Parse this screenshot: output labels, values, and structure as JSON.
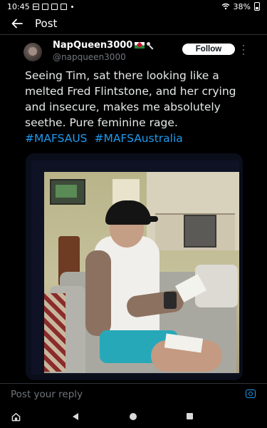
{
  "status_bar": {
    "time": "10:45",
    "battery": "38%"
  },
  "header": {
    "title": "Post"
  },
  "post": {
    "display_name": "NapQueen3000",
    "handle": "@napqueen3000",
    "follow_label": "Follow",
    "text_lines": [
      "Seeing Tim, sat there looking like a",
      "melted Fred Flintstone, and her crying",
      "and insecure, makes me absolutely",
      "seethe. Pure feminine rage."
    ],
    "hashtags": [
      "#MAFSAUS",
      "#MAFSAustralia"
    ]
  },
  "reply": {
    "placeholder": "Post your reply"
  },
  "colors": {
    "background": "#000000",
    "accent": "#1d9bf0",
    "text": "#e7e9ea",
    "muted": "#71767b"
  }
}
